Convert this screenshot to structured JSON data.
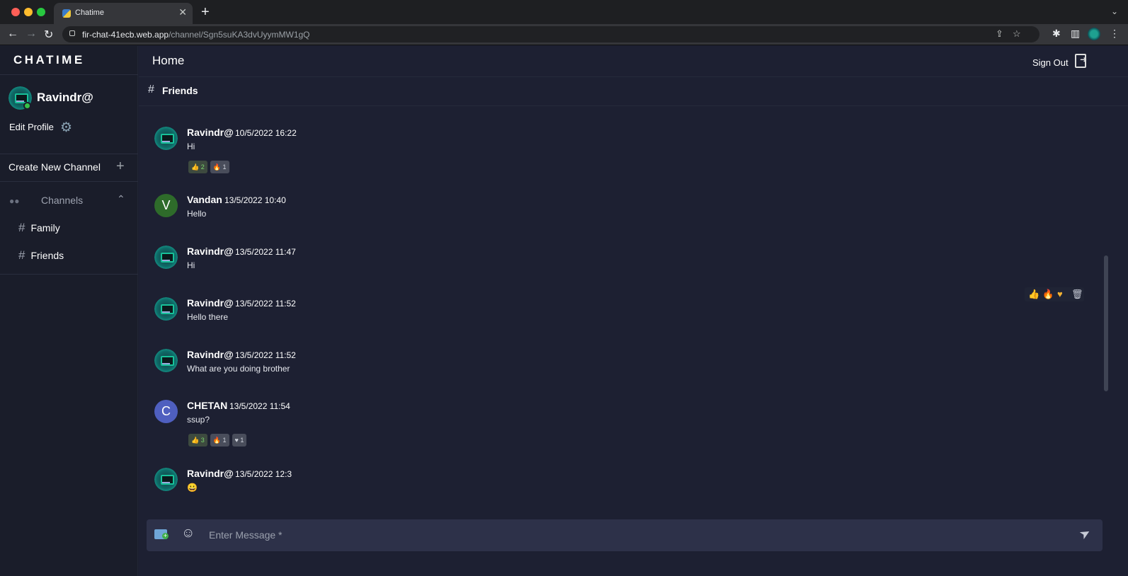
{
  "browser": {
    "tab_title": "Chatime",
    "url_host": "fir-chat-41ecb.web.app",
    "url_path": "/channel/Sgn5suKA3dvUyymMW1gQ"
  },
  "sidebar": {
    "brand": "CHATIME",
    "user_name": "Ravindr@",
    "edit_profile": "Edit Profile",
    "create_channel": "Create New Channel",
    "channels_label": "Channels",
    "channels": [
      {
        "name": "Family"
      },
      {
        "name": "Friends"
      }
    ]
  },
  "header": {
    "title": "Home",
    "sign_out": "Sign Out"
  },
  "channel": {
    "name": "Friends"
  },
  "messages": [
    {
      "author": "Ravindr@",
      "time": "10/5/2022 16:22",
      "text": "Hi",
      "avatar": "image",
      "reactions": [
        {
          "icon": "👍",
          "count": "2",
          "liked": true
        },
        {
          "icon": "🔥",
          "count": "1"
        }
      ]
    },
    {
      "author": "Vandan",
      "time": "13/5/2022 10:40",
      "text": "Hello",
      "avatar": "V",
      "avatar_color": "#2e6b2a"
    },
    {
      "author": "Ravindr@",
      "time": "13/5/2022 11:47",
      "text": "Hi",
      "avatar": "image"
    },
    {
      "author": "Ravindr@",
      "time": "13/5/2022 11:52",
      "text": "Hello there",
      "avatar": "image"
    },
    {
      "author": "Ravindr@",
      "time": "13/5/2022 11:52",
      "text": "What are you doing brother",
      "avatar": "image"
    },
    {
      "author": "CHETAN",
      "time": "13/5/2022 11:54",
      "text": "ssup?",
      "avatar": "C",
      "avatar_color": "#4f5fbf",
      "reactions": [
        {
          "icon": "👍",
          "count": "3",
          "liked": true
        },
        {
          "icon": "🔥",
          "count": "1"
        },
        {
          "icon": "♥",
          "count": "1"
        }
      ]
    },
    {
      "author": "Ravindr@",
      "time": "13/5/2022 12:3",
      "text": "😀",
      "avatar": "image"
    }
  ],
  "hover_actions": [
    "thumbs-up-icon",
    "fire-icon",
    "heart-icon",
    "trash-icon"
  ],
  "composer": {
    "placeholder": "Enter Message *"
  }
}
